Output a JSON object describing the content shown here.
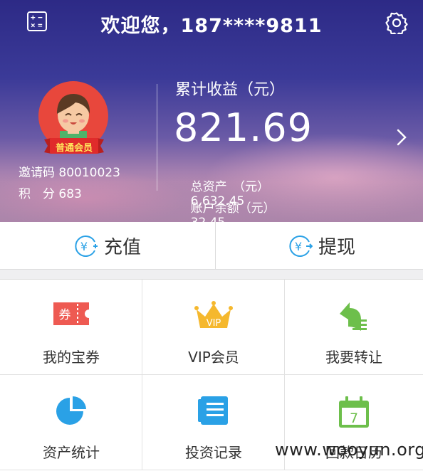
{
  "header": {
    "title": "欢迎您，187****9811",
    "calc_icon": "calculator-icon",
    "settings_icon": "gear-icon",
    "member_level": "普通会员",
    "invite_code_label": "邀请码",
    "invite_code": "80010023",
    "points_label": "积　分",
    "points": "683",
    "earnings_label": "累计收益（元）",
    "earnings_value": "821.69",
    "total_assets_label": "总资产　（元）",
    "total_assets_value": "6,632.45",
    "balance_label": "账户余额（元）",
    "balance_value": "32.45",
    "colors": {
      "header_top": "#2d2a86",
      "header_bottom": "#c79cba",
      "avatar_bg": "#e8473c"
    }
  },
  "actions": {
    "recharge": {
      "label": "充值",
      "icon": "yen-plus-icon"
    },
    "withdraw": {
      "label": "提现",
      "icon": "yen-transfer-icon"
    },
    "accent": "#2aa1e6"
  },
  "menu": [
    {
      "label": "我的宝券",
      "icon": "coupon-icon",
      "icon_text": "券",
      "color": "#ee5a52"
    },
    {
      "label": "VIP会员",
      "icon": "crown-icon",
      "icon_text": "VIP",
      "color": "#f5b82e"
    },
    {
      "label": "我要转让",
      "icon": "transfer-icon",
      "color": "#6dbf4b"
    },
    {
      "label": "资产统计",
      "icon": "pie-chart-icon",
      "color": "#2aa1e6"
    },
    {
      "label": "投资记录",
      "icon": "record-list-icon",
      "color": "#2aa1e6"
    },
    {
      "label": "回款日历",
      "icon": "calendar-icon",
      "icon_text": "7",
      "color": "#6dbf4b"
    }
  ],
  "watermark": "www.wooyun.org"
}
